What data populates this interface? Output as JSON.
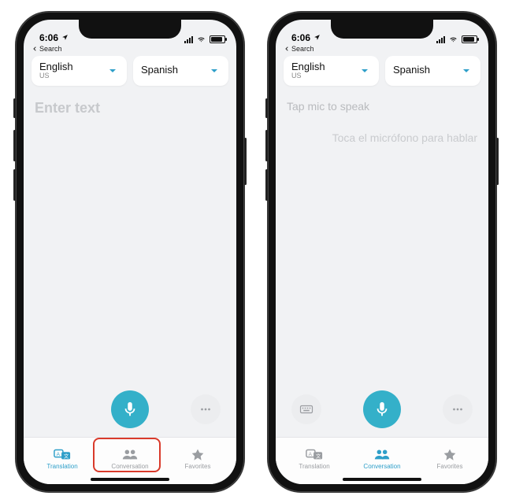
{
  "status": {
    "time": "6:06",
    "back_label": "Search"
  },
  "languages": {
    "left": {
      "main": "English",
      "sub": "US"
    },
    "right": {
      "main": "Spanish",
      "sub": ""
    }
  },
  "left_screen": {
    "placeholder": "Enter text",
    "tabs": {
      "translation": "Translation",
      "conversation": "Conversation",
      "favorites": "Favorites",
      "active": "translation"
    }
  },
  "right_screen": {
    "hint_source": "Tap mic to speak",
    "hint_target": "Toca el micrófono para hablar",
    "tabs": {
      "translation": "Translation",
      "conversation": "Conversation",
      "favorites": "Favorites",
      "active": "conversation"
    }
  },
  "colors": {
    "accent": "#2e9fc9",
    "mic": "#34b0c9",
    "highlight": "#d93a2b"
  }
}
